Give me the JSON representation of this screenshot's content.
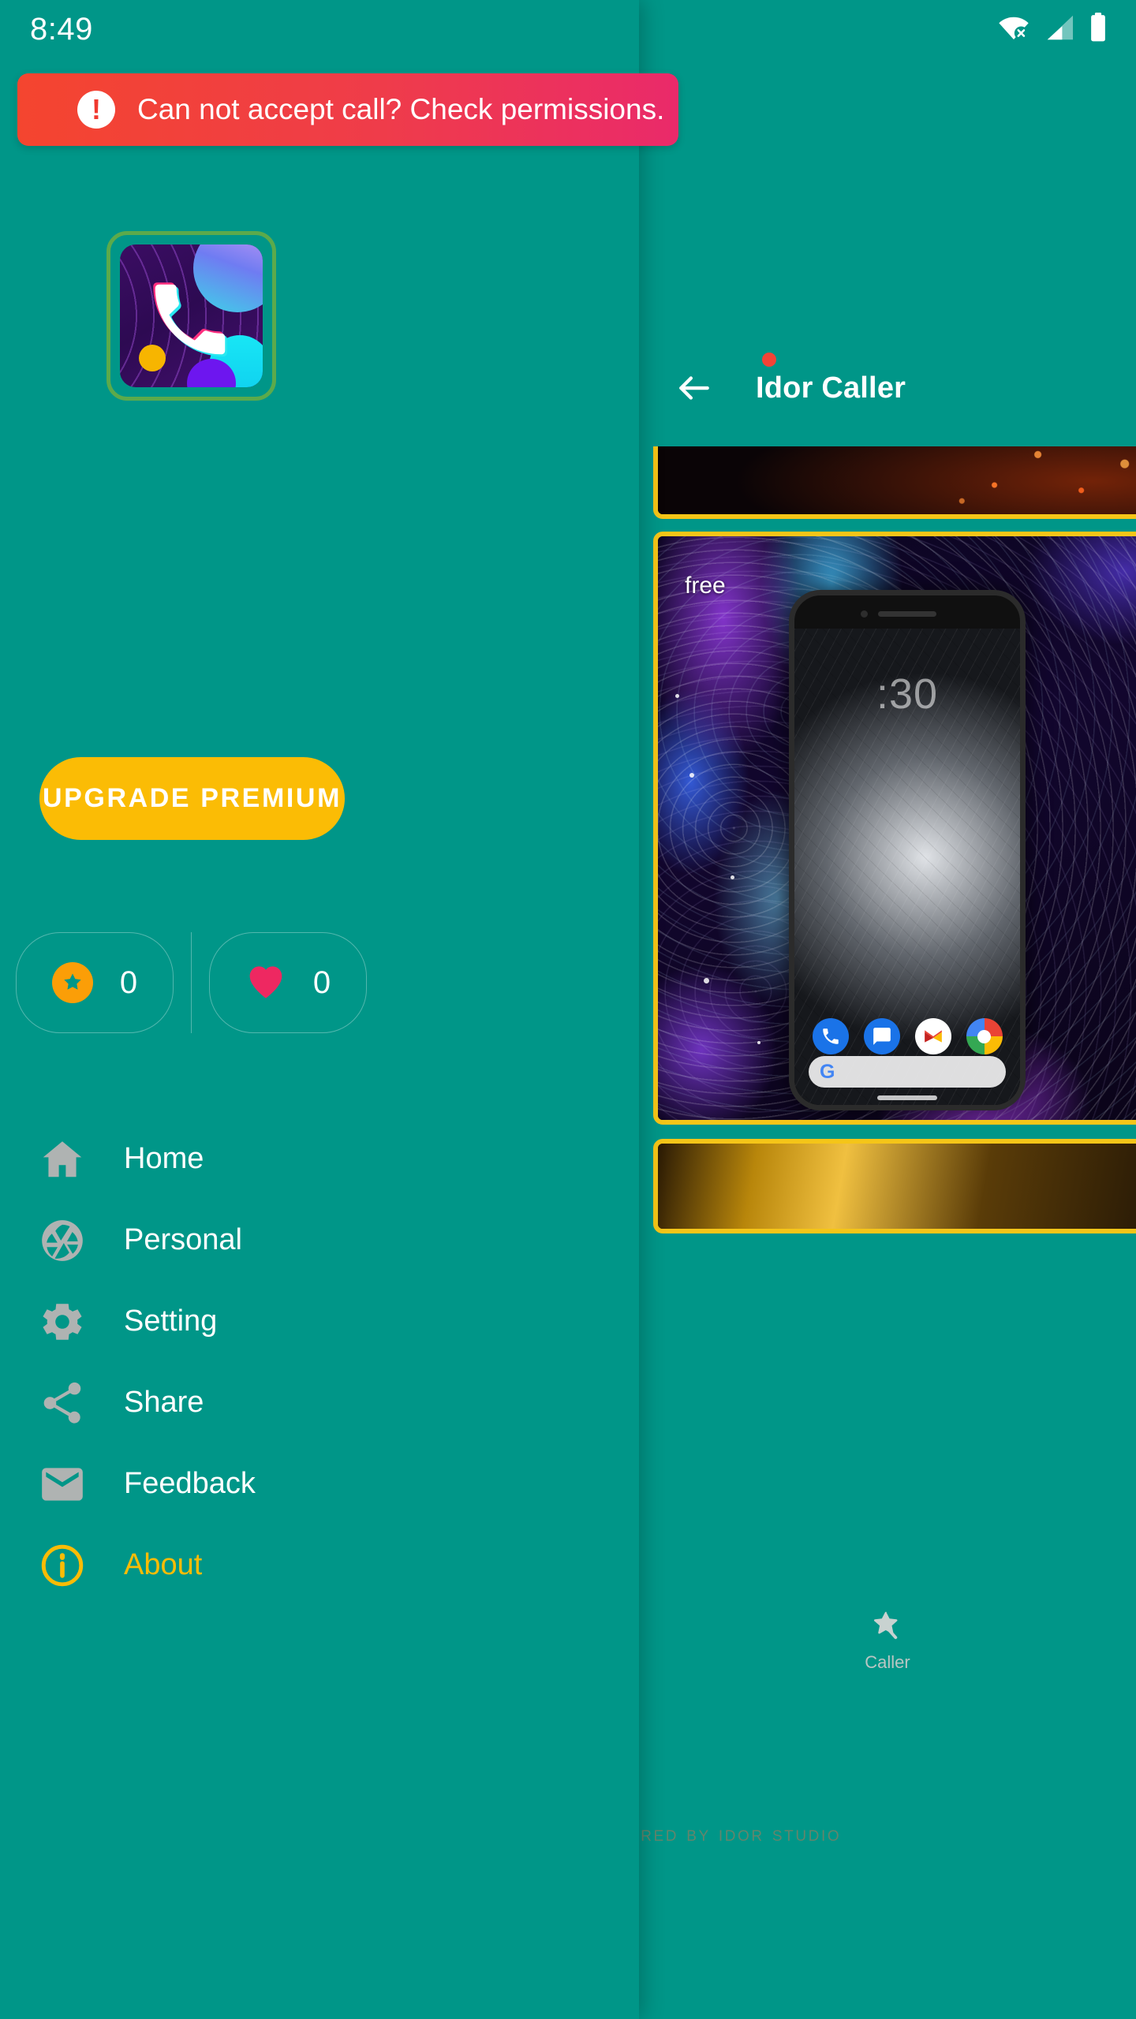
{
  "theme": {
    "background": "#009688",
    "accent_yellow": "#FBBC05",
    "accent_orange": "#FB9E07",
    "accent_pink": "#EE2861",
    "banner_gradient_start": "#F4452F",
    "banner_gradient_end": "#EA2A6A",
    "icon_gray": "#AFB3B2"
  },
  "status_bar": {
    "clock": "8:49",
    "icons": [
      {
        "name": "wifi-off-icon",
        "label": "wifi-no-internet"
      },
      {
        "name": "cellular-signal-icon",
        "label": "signal-partial"
      },
      {
        "name": "battery-full-icon",
        "label": "battery-full"
      }
    ]
  },
  "warning_banner": {
    "icon": "exclamation-circle-icon",
    "text": "Can not accept call? Check permissions."
  },
  "drawer": {
    "app_icon": {
      "name": "idor-caller-app-icon",
      "glyph": "phone-handset"
    },
    "upgrade_button": "UPGRADE PREMIUM",
    "stats": [
      {
        "icon": "star-icon",
        "name": "star-count",
        "value": "0"
      },
      {
        "icon": "heart-icon",
        "name": "heart-count",
        "value": "0"
      }
    ],
    "nav_items": [
      {
        "label": "Home",
        "icon": "home-icon",
        "active": false
      },
      {
        "label": "Personal",
        "icon": "aperture-icon",
        "active": false
      },
      {
        "label": "Setting",
        "icon": "gear-icon",
        "active": false
      },
      {
        "label": "Share",
        "icon": "share-icon",
        "active": false
      },
      {
        "label": "Feedback",
        "icon": "envelope-icon",
        "active": false
      },
      {
        "label": "About",
        "icon": "info-circle-icon",
        "active": true
      }
    ]
  },
  "content": {
    "back_icon": "back-arrow-icon",
    "title": "Idor Caller",
    "notification_dot": true,
    "cards": [
      {
        "name": "wallpaper-card-top",
        "badge": ""
      },
      {
        "name": "wallpaper-card-middle",
        "badge": "free"
      },
      {
        "name": "wallpaper-card-bottom",
        "badge": ""
      }
    ],
    "phone_mock": {
      "clock": ":30",
      "dock_icons": [
        "phone-icon",
        "messages-icon",
        "gmail-icon",
        "chrome-icon"
      ],
      "search_glyph": "G"
    },
    "bottom_nav": [
      {
        "label": "Caller",
        "icon": "magic-star-icon",
        "active": true
      }
    ]
  },
  "footer": {
    "powered_by": "Powered by Idor Studio"
  }
}
